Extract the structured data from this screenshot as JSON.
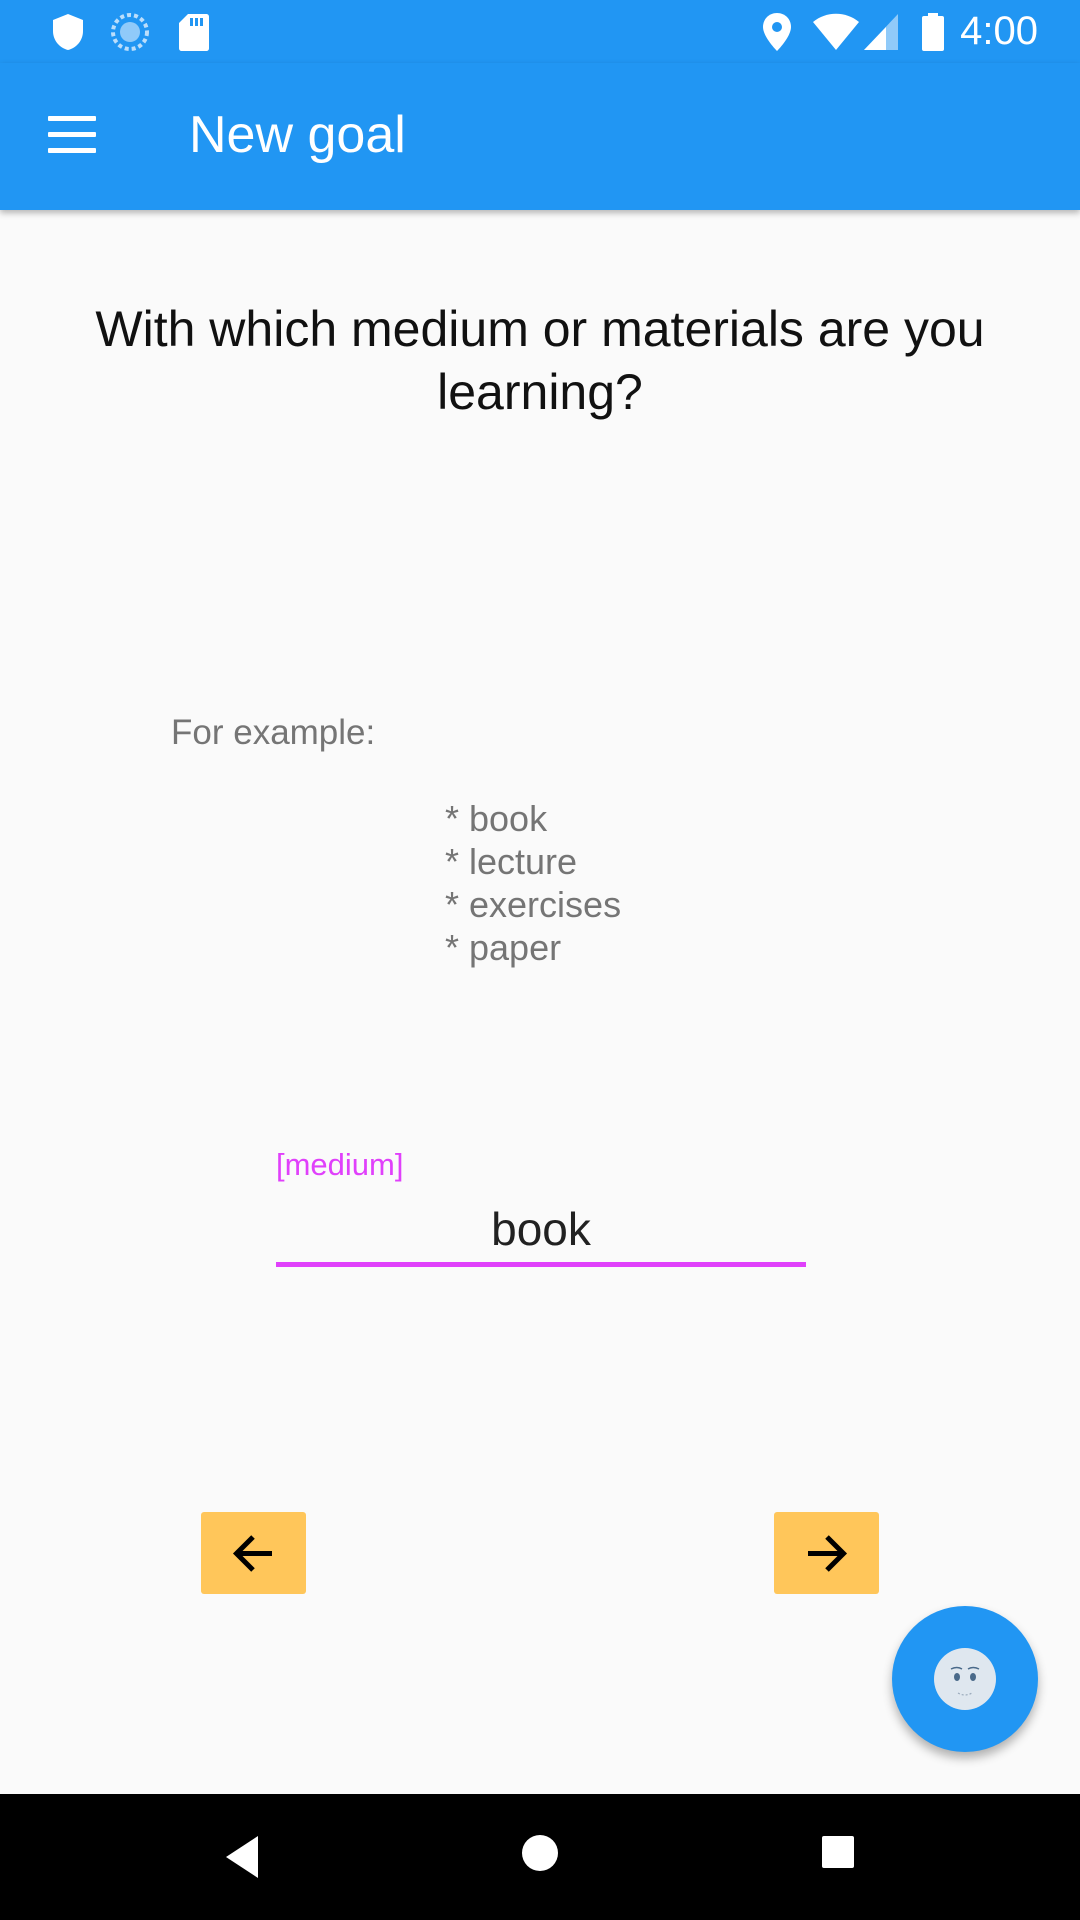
{
  "status_bar": {
    "icons": [
      "shield-icon",
      "sync-icon",
      "sd-card-icon",
      "location-icon",
      "wifi-icon",
      "signal-icon",
      "battery-icon"
    ],
    "time": "4:00"
  },
  "app_bar": {
    "menu_icon": "menu-icon",
    "title": "New goal"
  },
  "main": {
    "question": "With which medium or materials are you learning?",
    "example_label": "For example:",
    "examples": [
      "* book",
      "* lecture",
      "* exercises",
      "* paper"
    ],
    "field": {
      "label": "[medium]",
      "value": "book"
    },
    "prev_icon": "arrow-left-icon",
    "next_icon": "arrow-right-icon",
    "fab_icon": "assistant-face-icon"
  },
  "nav_bar": {
    "icons": [
      "back-icon",
      "home-icon",
      "recents-icon"
    ]
  },
  "colors": {
    "primary": "#2196f3",
    "accent": "#e040fb",
    "button": "#ffc65a",
    "text_secondary": "#757575"
  }
}
